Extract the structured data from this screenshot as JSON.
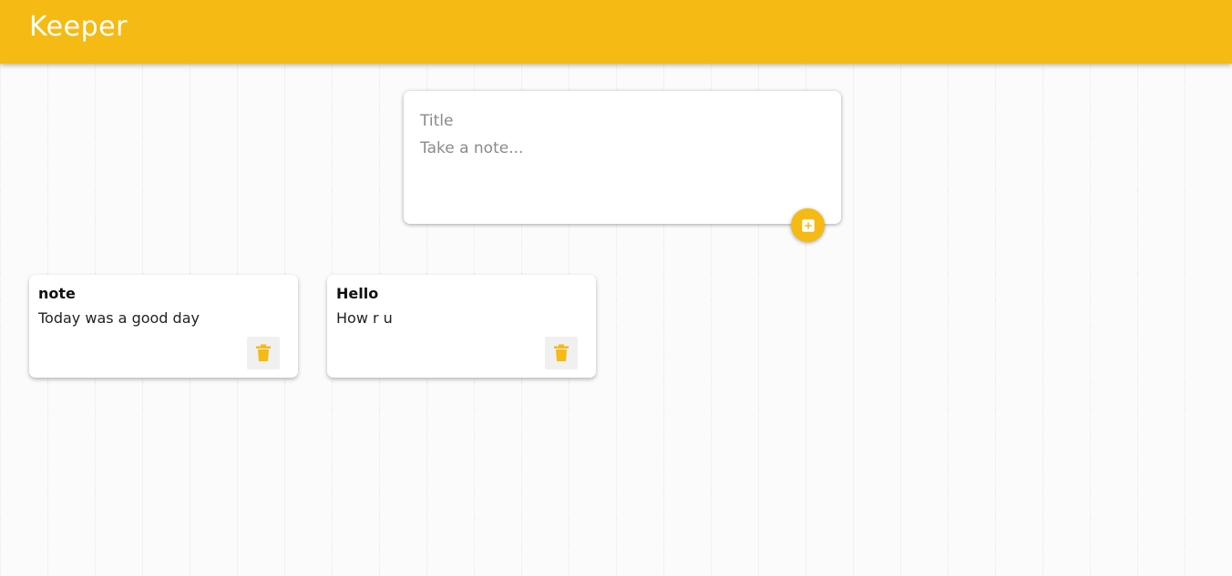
{
  "header": {
    "title": "Keeper",
    "color": "#f5ba13"
  },
  "create_note": {
    "title_placeholder": "Title",
    "content_placeholder": "Take a note...",
    "title_value": "",
    "content_value": "",
    "add_icon": "add-box-icon"
  },
  "notes": [
    {
      "title": "note",
      "content": "Today was a good day",
      "delete_icon": "trash-icon"
    },
    {
      "title": "Hello",
      "content": "How r u",
      "delete_icon": "trash-icon"
    }
  ]
}
